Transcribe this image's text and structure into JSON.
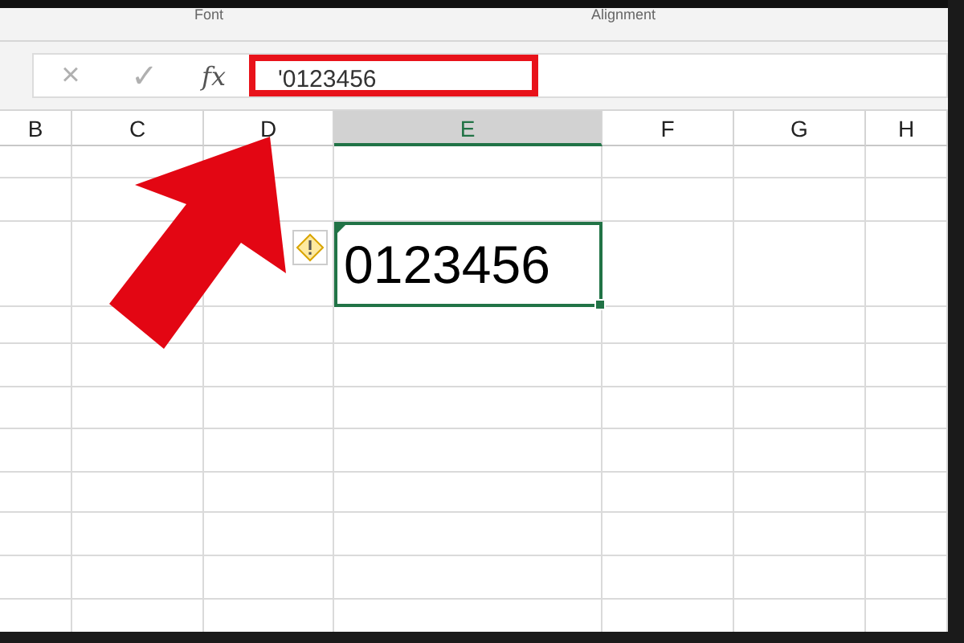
{
  "ribbon_groups": [
    {
      "label": "Font"
    },
    {
      "label": "Alignment"
    }
  ],
  "formula_bar": {
    "cancel": "×",
    "enter": "✓",
    "function_label": "fx",
    "value": "'0123456",
    "highlighted": true
  },
  "columns": [
    {
      "label": "B",
      "selected": false
    },
    {
      "label": "C",
      "selected": false
    },
    {
      "label": "D",
      "selected": false
    },
    {
      "label": "E",
      "selected": true
    },
    {
      "label": "F",
      "selected": false
    },
    {
      "label": "G",
      "selected": false
    },
    {
      "label": "H",
      "selected": false
    }
  ],
  "active_cell": {
    "value": "0123456",
    "warning": true
  },
  "annotation": {
    "kind": "arrow"
  }
}
